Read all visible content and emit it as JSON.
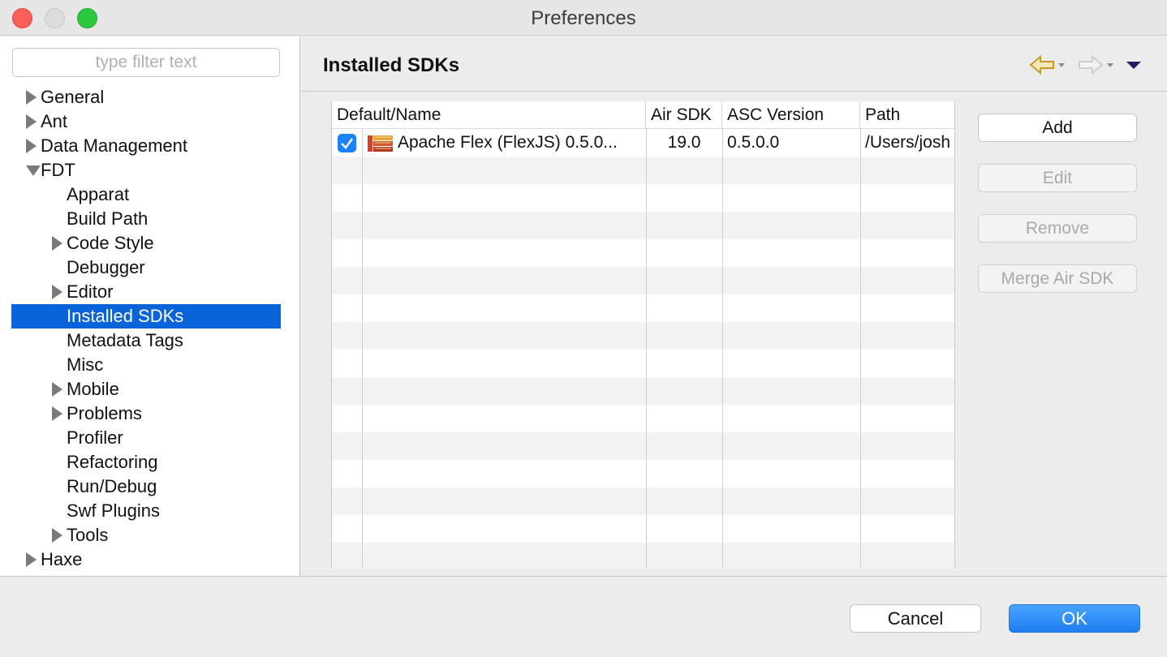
{
  "window": {
    "title": "Preferences"
  },
  "filter": {
    "placeholder": "type filter text",
    "value": ""
  },
  "tree": [
    {
      "label": "General",
      "level": 0,
      "twisty": "closed"
    },
    {
      "label": "Ant",
      "level": 0,
      "twisty": "closed"
    },
    {
      "label": "Data Management",
      "level": 0,
      "twisty": "closed"
    },
    {
      "label": "FDT",
      "level": 0,
      "twisty": "open"
    },
    {
      "label": "Apparat",
      "level": 1,
      "twisty": "none"
    },
    {
      "label": "Build Path",
      "level": 1,
      "twisty": "none"
    },
    {
      "label": "Code Style",
      "level": 1,
      "twisty": "closed"
    },
    {
      "label": "Debugger",
      "level": 1,
      "twisty": "none"
    },
    {
      "label": "Editor",
      "level": 1,
      "twisty": "closed"
    },
    {
      "label": "Installed SDKs",
      "level": 1,
      "twisty": "none",
      "selected": true
    },
    {
      "label": "Metadata Tags",
      "level": 1,
      "twisty": "none"
    },
    {
      "label": "Misc",
      "level": 1,
      "twisty": "none"
    },
    {
      "label": "Mobile",
      "level": 1,
      "twisty": "closed"
    },
    {
      "label": "Problems",
      "level": 1,
      "twisty": "closed"
    },
    {
      "label": "Profiler",
      "level": 1,
      "twisty": "none"
    },
    {
      "label": "Refactoring",
      "level": 1,
      "twisty": "none"
    },
    {
      "label": "Run/Debug",
      "level": 1,
      "twisty": "none"
    },
    {
      "label": "Swf Plugins",
      "level": 1,
      "twisty": "none"
    },
    {
      "label": "Tools",
      "level": 1,
      "twisty": "closed"
    },
    {
      "label": "Haxe",
      "level": 0,
      "twisty": "closed"
    }
  ],
  "page": {
    "title": "Installed SDKs"
  },
  "nav": {
    "back_icon": "back-arrow-icon",
    "forward_icon": "forward-arrow-icon",
    "menu_icon": "view-menu-icon"
  },
  "table": {
    "columns": [
      "Default/Name",
      "Air SDK",
      "ASC Version",
      "Path"
    ],
    "rows": [
      {
        "checked": true,
        "name": "Apache Flex (FlexJS) 0.5.0...",
        "air_sdk": "19.0",
        "asc_version": "0.5.0.0",
        "path": "/Users/josh"
      }
    ]
  },
  "buttons": {
    "add": "Add",
    "edit": "Edit",
    "remove": "Remove",
    "merge": "Merge Air SDK",
    "cancel": "Cancel",
    "ok": "OK"
  },
  "colors": {
    "selection": "#0a64d9",
    "ok_button": "#1d7ef0",
    "checkbox": "#1a82fb"
  }
}
